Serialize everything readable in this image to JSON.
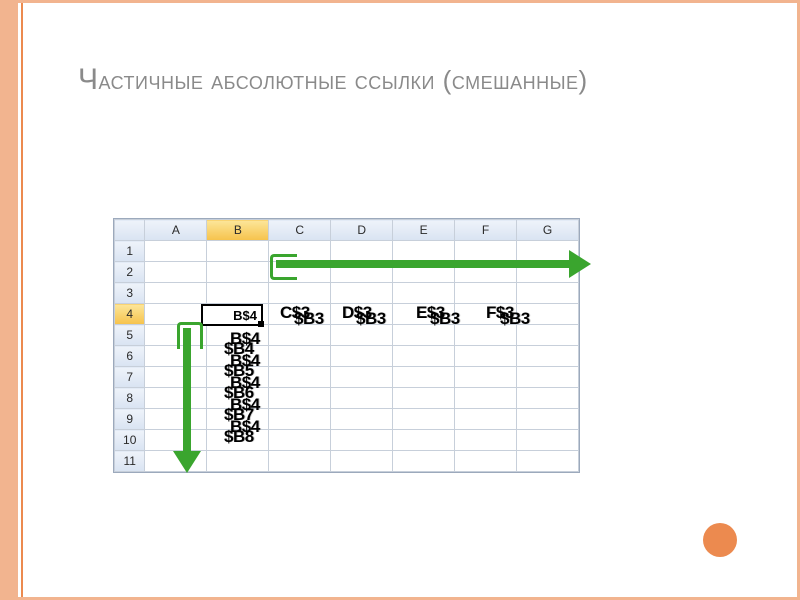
{
  "title": {
    "cap": "Ч",
    "rest": "астичные абсолютные ссылки (смешанные)"
  },
  "sheet": {
    "columns": [
      "A",
      "B",
      "C",
      "D",
      "E",
      "F",
      "G"
    ],
    "rows": [
      "1",
      "2",
      "3",
      "4",
      "5",
      "6",
      "7",
      "8",
      "9",
      "10",
      "11"
    ],
    "active_col_index": 1,
    "active_row_index": 3,
    "active_value": "B$4"
  },
  "overlays": {
    "row4": [
      {
        "top_left": "C$3",
        "bottom_right": "$B3"
      },
      {
        "top_left": "D$3",
        "bottom_right": "$B3"
      },
      {
        "top_left": "E$3",
        "bottom_right": "$B3"
      },
      {
        "top_left": "F$3",
        "bottom_right": "$B3"
      }
    ],
    "colB": [
      {
        "top": "B$4",
        "bottom": "$B4"
      },
      {
        "top": "B$4",
        "bottom": "$B5"
      },
      {
        "top": "B$4",
        "bottom": "$B6"
      },
      {
        "top": "B$4",
        "bottom": "$B7"
      },
      {
        "top": "B$4",
        "bottom": "$B8"
      }
    ]
  }
}
